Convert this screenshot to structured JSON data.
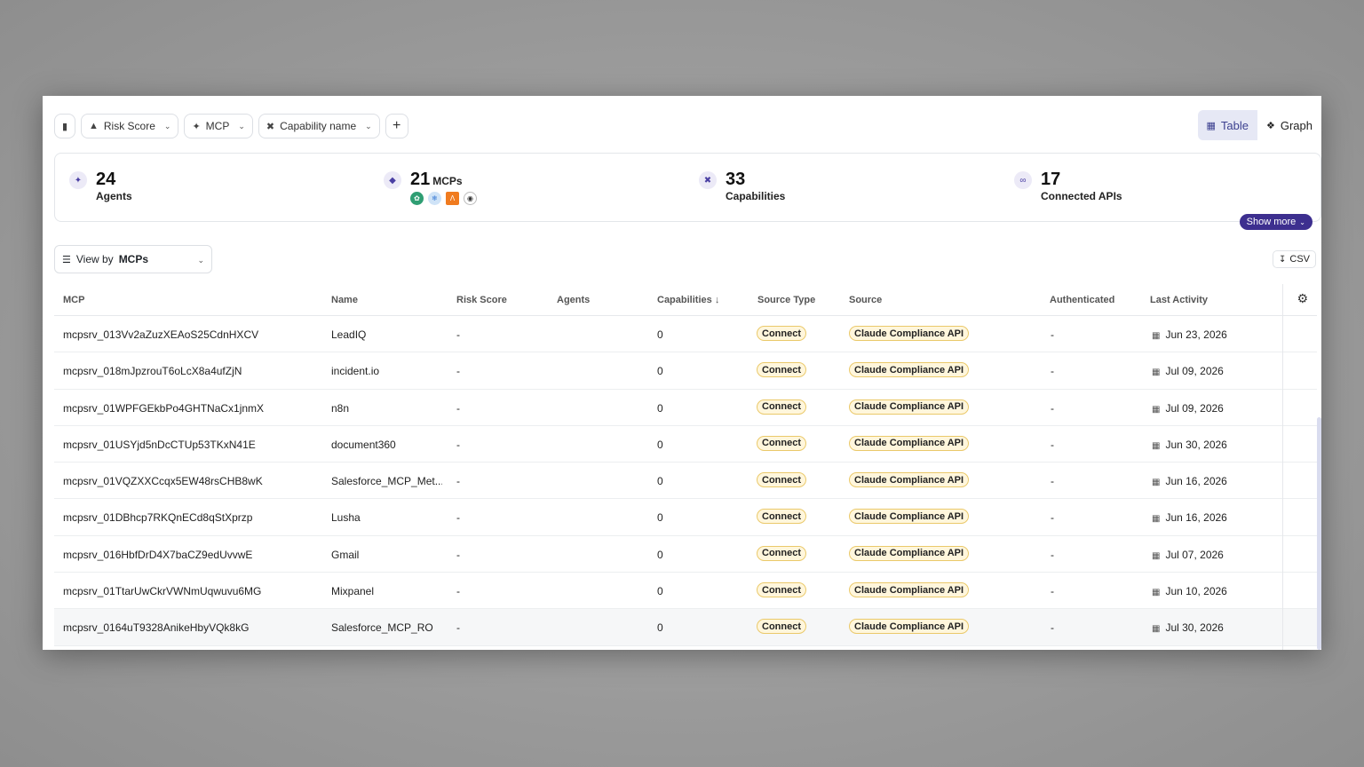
{
  "filters": {
    "bookmark_icon": "bookmark-icon",
    "items": [
      {
        "label": "Risk Score",
        "icon": "warning-icon"
      },
      {
        "label": "MCP",
        "icon": "mcp-icon"
      },
      {
        "label": "Capability name",
        "icon": "tools-icon"
      }
    ],
    "add_label": "+"
  },
  "view_toggle": {
    "table_label": "Table",
    "graph_label": "Graph",
    "active": "Table"
  },
  "stats": {
    "agents": {
      "value": "24",
      "label": "Agents"
    },
    "mcps": {
      "value": "21",
      "suffix": "MCPs"
    },
    "capabilities": {
      "value": "33",
      "label": "Capabilities"
    },
    "apis": {
      "value": "17",
      "label": "Connected APIs"
    },
    "show_more_label": "Show more"
  },
  "viewby": {
    "prefix": "View by",
    "value": "MCPs"
  },
  "csv_label": "CSV",
  "table": {
    "columns": [
      "MCP",
      "Name",
      "Risk Score",
      "Agents",
      "Capabilities",
      "Source Type",
      "Source",
      "Authenticated",
      "Last Activity"
    ],
    "sort_indicator": "↓",
    "rows": [
      {
        "mcp": "mcpsrv_013Vv2aZuzXEAoS25CdnHXCV",
        "name": "LeadIQ",
        "risk": "-",
        "agents": "",
        "caps": "0",
        "stype": "Connect",
        "source": "Claude Compliance API",
        "auth": "-",
        "last": "Jun 23, 2026"
      },
      {
        "mcp": "mcpsrv_018mJpzrouT6oLcX8a4ufZjN",
        "name": "incident.io",
        "risk": "-",
        "agents": "",
        "caps": "0",
        "stype": "Connect",
        "source": "Claude Compliance API",
        "auth": "-",
        "last": "Jul 09, 2026"
      },
      {
        "mcp": "mcpsrv_01WPFGEkbPo4GHTNaCx1jnmX",
        "name": "n8n",
        "risk": "-",
        "agents": "",
        "caps": "0",
        "stype": "Connect",
        "source": "Claude Compliance API",
        "auth": "-",
        "last": "Jul 09, 2026"
      },
      {
        "mcp": "mcpsrv_01USYjd5nDcCTUp53TKxN41E",
        "name": "document360",
        "risk": "-",
        "agents": "",
        "caps": "0",
        "stype": "Connect",
        "source": "Claude Compliance API",
        "auth": "-",
        "last": "Jun 30, 2026"
      },
      {
        "mcp": "mcpsrv_01VQZXXCcqx5EW48rsCHB8wK",
        "name": "Salesforce_MCP_Met...",
        "risk": "-",
        "agents": "",
        "caps": "0",
        "stype": "Connect",
        "source": "Claude Compliance API",
        "auth": "-",
        "last": "Jun 16, 2026"
      },
      {
        "mcp": "mcpsrv_01DBhcp7RKQnECd8qStXprzp",
        "name": "Lusha",
        "risk": "-",
        "agents": "",
        "caps": "0",
        "stype": "Connect",
        "source": "Claude Compliance API",
        "auth": "-",
        "last": "Jun 16, 2026"
      },
      {
        "mcp": "mcpsrv_016HbfDrD4X7baCZ9edUvvwE",
        "name": "Gmail",
        "risk": "-",
        "agents": "",
        "caps": "0",
        "stype": "Connect",
        "source": "Claude Compliance API",
        "auth": "-",
        "last": "Jul 07, 2026"
      },
      {
        "mcp": "mcpsrv_01TtarUwCkrVWNmUqwuvu6MG",
        "name": "Mixpanel",
        "risk": "-",
        "agents": "",
        "caps": "0",
        "stype": "Connect",
        "source": "Claude Compliance API",
        "auth": "-",
        "last": "Jun 10, 2026"
      },
      {
        "mcp": "mcpsrv_0164uT9328AnikeHbyVQk8kG",
        "name": "Salesforce_MCP_RO",
        "risk": "-",
        "agents": "",
        "caps": "0",
        "stype": "Connect",
        "source": "Claude Compliance API",
        "auth": "-",
        "last": "Jul 30, 2026"
      }
    ]
  }
}
